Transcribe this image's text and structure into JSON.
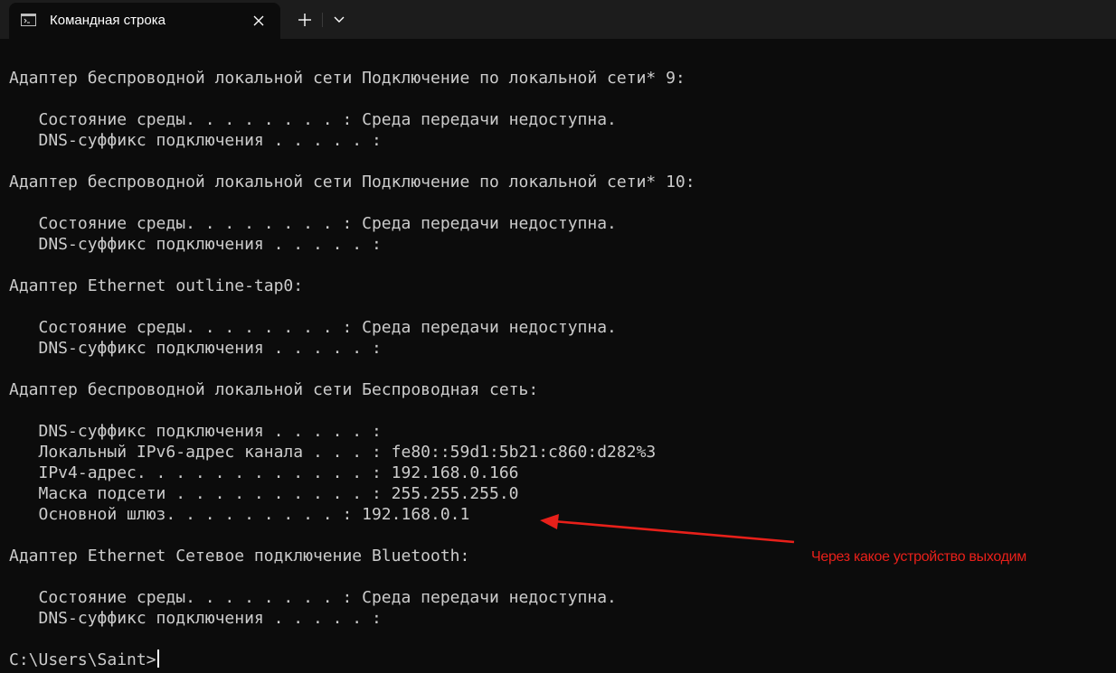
{
  "tab": {
    "title": "Командная строка",
    "icon": "cmd-icon"
  },
  "toolbar": {
    "close_icon": "close-icon",
    "new_tab_icon": "plus-icon",
    "dropdown_icon": "chevron-down-icon"
  },
  "console": {
    "lines": [
      "",
      "Адаптер беспроводной локальной сети Подключение по локальной сети* 9:",
      "",
      "   Состояние среды. . . . . . . . : Среда передачи недоступна.",
      "   DNS-суффикс подключения . . . . . :",
      "",
      "Адаптер беспроводной локальной сети Подключение по локальной сети* 10:",
      "",
      "   Состояние среды. . . . . . . . : Среда передачи недоступна.",
      "   DNS-суффикс подключения . . . . . :",
      "",
      "Адаптер Ethernet outline-tap0:",
      "",
      "   Состояние среды. . . . . . . . : Среда передачи недоступна.",
      "   DNS-суффикс подключения . . . . . :",
      "",
      "Адаптер беспроводной локальной сети Беспроводная сеть:",
      "",
      "   DNS-суффикс подключения . . . . . :",
      "   Локальный IPv6-адрес канала . . . : fe80::59d1:5b21:c860:d282%3",
      "   IPv4-адрес. . . . . . . . . . . . : 192.168.0.166",
      "   Маска подсети . . . . . . . . . . : 255.255.255.0",
      "   Основной шлюз. . . . . . . . . : 192.168.0.1",
      "",
      "Адаптер Ethernet Сетевое подключение Bluetooth:",
      "",
      "   Состояние среды. . . . . . . . : Среда передачи недоступна.",
      "   DNS-суффикс подключения . . . . . :",
      ""
    ],
    "prompt": "C:\\Users\\Saint>"
  },
  "annotation": {
    "text": "Через какое устройство выходим",
    "color": "#e8201a"
  },
  "colors": {
    "background": "#0c0c0c",
    "tabbar": "#1c1c1c",
    "text": "#cccccc"
  }
}
